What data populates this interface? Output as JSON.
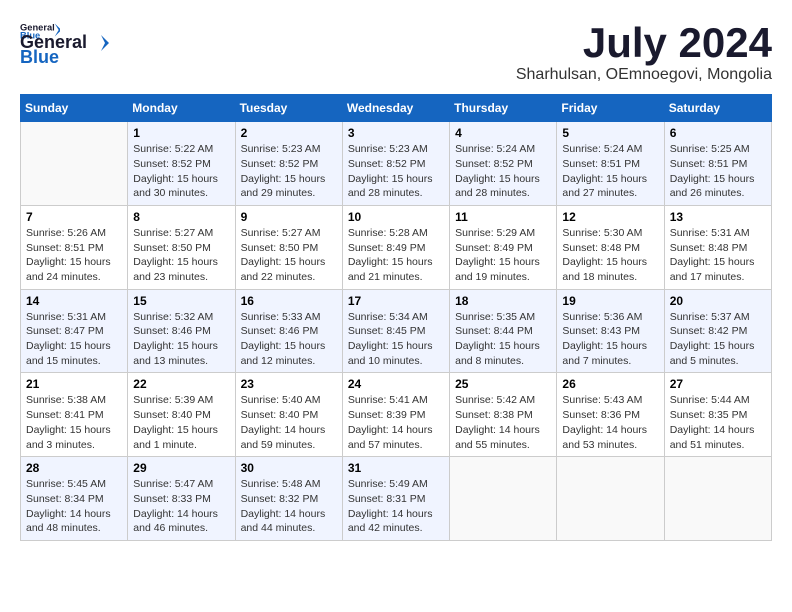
{
  "header": {
    "logo_general": "General",
    "logo_blue": "Blue",
    "month_title": "July 2024",
    "location": "Sharhulsan, OEmnoegovi, Mongolia"
  },
  "calendar": {
    "days_of_week": [
      "Sunday",
      "Monday",
      "Tuesday",
      "Wednesday",
      "Thursday",
      "Friday",
      "Saturday"
    ],
    "weeks": [
      [
        {
          "day": "",
          "info": ""
        },
        {
          "day": "1",
          "info": "Sunrise: 5:22 AM\nSunset: 8:52 PM\nDaylight: 15 hours\nand 30 minutes."
        },
        {
          "day": "2",
          "info": "Sunrise: 5:23 AM\nSunset: 8:52 PM\nDaylight: 15 hours\nand 29 minutes."
        },
        {
          "day": "3",
          "info": "Sunrise: 5:23 AM\nSunset: 8:52 PM\nDaylight: 15 hours\nand 28 minutes."
        },
        {
          "day": "4",
          "info": "Sunrise: 5:24 AM\nSunset: 8:52 PM\nDaylight: 15 hours\nand 28 minutes."
        },
        {
          "day": "5",
          "info": "Sunrise: 5:24 AM\nSunset: 8:51 PM\nDaylight: 15 hours\nand 27 minutes."
        },
        {
          "day": "6",
          "info": "Sunrise: 5:25 AM\nSunset: 8:51 PM\nDaylight: 15 hours\nand 26 minutes."
        }
      ],
      [
        {
          "day": "7",
          "info": "Sunrise: 5:26 AM\nSunset: 8:51 PM\nDaylight: 15 hours\nand 24 minutes."
        },
        {
          "day": "8",
          "info": "Sunrise: 5:27 AM\nSunset: 8:50 PM\nDaylight: 15 hours\nand 23 minutes."
        },
        {
          "day": "9",
          "info": "Sunrise: 5:27 AM\nSunset: 8:50 PM\nDaylight: 15 hours\nand 22 minutes."
        },
        {
          "day": "10",
          "info": "Sunrise: 5:28 AM\nSunset: 8:49 PM\nDaylight: 15 hours\nand 21 minutes."
        },
        {
          "day": "11",
          "info": "Sunrise: 5:29 AM\nSunset: 8:49 PM\nDaylight: 15 hours\nand 19 minutes."
        },
        {
          "day": "12",
          "info": "Sunrise: 5:30 AM\nSunset: 8:48 PM\nDaylight: 15 hours\nand 18 minutes."
        },
        {
          "day": "13",
          "info": "Sunrise: 5:31 AM\nSunset: 8:48 PM\nDaylight: 15 hours\nand 17 minutes."
        }
      ],
      [
        {
          "day": "14",
          "info": "Sunrise: 5:31 AM\nSunset: 8:47 PM\nDaylight: 15 hours\nand 15 minutes."
        },
        {
          "day": "15",
          "info": "Sunrise: 5:32 AM\nSunset: 8:46 PM\nDaylight: 15 hours\nand 13 minutes."
        },
        {
          "day": "16",
          "info": "Sunrise: 5:33 AM\nSunset: 8:46 PM\nDaylight: 15 hours\nand 12 minutes."
        },
        {
          "day": "17",
          "info": "Sunrise: 5:34 AM\nSunset: 8:45 PM\nDaylight: 15 hours\nand 10 minutes."
        },
        {
          "day": "18",
          "info": "Sunrise: 5:35 AM\nSunset: 8:44 PM\nDaylight: 15 hours\nand 8 minutes."
        },
        {
          "day": "19",
          "info": "Sunrise: 5:36 AM\nSunset: 8:43 PM\nDaylight: 15 hours\nand 7 minutes."
        },
        {
          "day": "20",
          "info": "Sunrise: 5:37 AM\nSunset: 8:42 PM\nDaylight: 15 hours\nand 5 minutes."
        }
      ],
      [
        {
          "day": "21",
          "info": "Sunrise: 5:38 AM\nSunset: 8:41 PM\nDaylight: 15 hours\nand 3 minutes."
        },
        {
          "day": "22",
          "info": "Sunrise: 5:39 AM\nSunset: 8:40 PM\nDaylight: 15 hours\nand 1 minute."
        },
        {
          "day": "23",
          "info": "Sunrise: 5:40 AM\nSunset: 8:40 PM\nDaylight: 14 hours\nand 59 minutes."
        },
        {
          "day": "24",
          "info": "Sunrise: 5:41 AM\nSunset: 8:39 PM\nDaylight: 14 hours\nand 57 minutes."
        },
        {
          "day": "25",
          "info": "Sunrise: 5:42 AM\nSunset: 8:38 PM\nDaylight: 14 hours\nand 55 minutes."
        },
        {
          "day": "26",
          "info": "Sunrise: 5:43 AM\nSunset: 8:36 PM\nDaylight: 14 hours\nand 53 minutes."
        },
        {
          "day": "27",
          "info": "Sunrise: 5:44 AM\nSunset: 8:35 PM\nDaylight: 14 hours\nand 51 minutes."
        }
      ],
      [
        {
          "day": "28",
          "info": "Sunrise: 5:45 AM\nSunset: 8:34 PM\nDaylight: 14 hours\nand 48 minutes."
        },
        {
          "day": "29",
          "info": "Sunrise: 5:47 AM\nSunset: 8:33 PM\nDaylight: 14 hours\nand 46 minutes."
        },
        {
          "day": "30",
          "info": "Sunrise: 5:48 AM\nSunset: 8:32 PM\nDaylight: 14 hours\nand 44 minutes."
        },
        {
          "day": "31",
          "info": "Sunrise: 5:49 AM\nSunset: 8:31 PM\nDaylight: 14 hours\nand 42 minutes."
        },
        {
          "day": "",
          "info": ""
        },
        {
          "day": "",
          "info": ""
        },
        {
          "day": "",
          "info": ""
        }
      ]
    ]
  }
}
